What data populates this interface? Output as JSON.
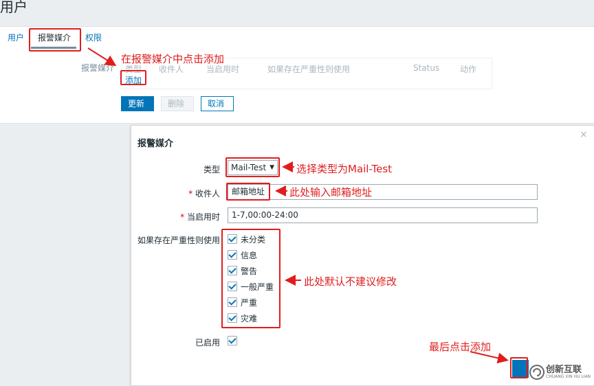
{
  "page": {
    "title": "用户"
  },
  "tabs": [
    {
      "label": "用户"
    },
    {
      "label": "报警媒介"
    },
    {
      "label": "权限"
    }
  ],
  "media_section": {
    "label": "报警媒介",
    "columns": [
      "类型",
      "收件人",
      "当启用时",
      "如果存在严重性则使用",
      "Status",
      "动作"
    ],
    "add_link": "添加"
  },
  "actions": {
    "update": "更新",
    "delete": "删除",
    "cancel": "取消"
  },
  "dialog": {
    "title": "报警媒介",
    "close": "×",
    "type_label": "类型",
    "type_value": "Mail-Test",
    "recipient_label": "收件人",
    "recipient_value": "邮箱地址",
    "when_active_label": "当启用时",
    "when_active_value": "1-7,00:00-24:00",
    "severity_label": "如果存在严重性则使用",
    "severities": [
      {
        "label": "未分类",
        "checked": true
      },
      {
        "label": "信息",
        "checked": true
      },
      {
        "label": "警告",
        "checked": true
      },
      {
        "label": "一般严重",
        "checked": true
      },
      {
        "label": "严重",
        "checked": true
      },
      {
        "label": "灾难",
        "checked": true
      }
    ],
    "enabled_label": "已启用",
    "enabled_checked": true
  },
  "annotations": {
    "click_add": "在报警媒介中点击添加",
    "choose_type": "选择类型为Mail-Test",
    "enter_email": "此处输入邮箱地址",
    "default_no_change": "此处默认不建议修改",
    "finally_add": "最后点击添加"
  },
  "watermark": {
    "text": "创新互联",
    "sub": "CHUANG XIN HU LIAN"
  },
  "colors": {
    "accent": "#0275b8",
    "annotation": "#e01d1d"
  }
}
